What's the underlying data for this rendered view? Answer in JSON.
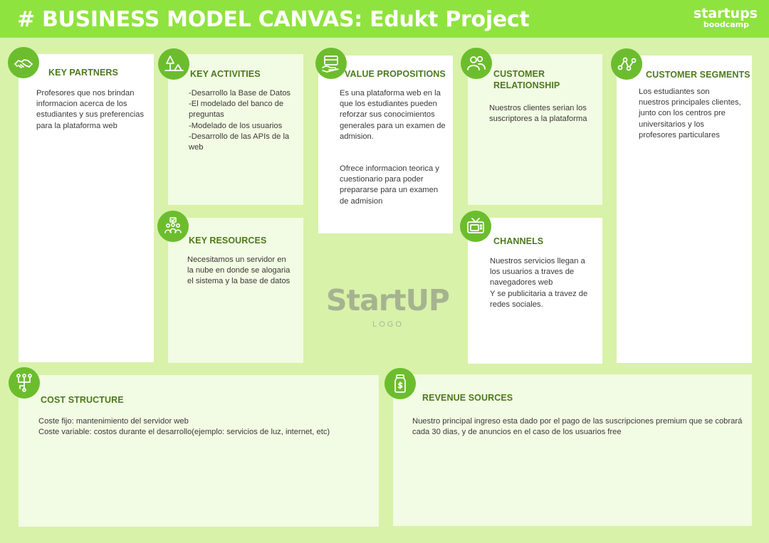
{
  "header": {
    "title": "# BUSINESS MODEL CANVAS: Edukt Project",
    "brand_main": "startups",
    "brand_sub": "boodcamp"
  },
  "blocks": {
    "key_partners": {
      "label": "KEY PARTNERS",
      "icon": "handshake-icon",
      "lines": [
        "Profesores que nos brindan informacion acerca de los estudiantes y sus preferencias para la plataforma web"
      ]
    },
    "key_activities": {
      "label": "KEY ACTIVITIES",
      "icon": "tree-tent-icon",
      "lines": [
        "-Desarrollo la Base de Datos",
        "-El modelado del banco de preguntas",
        "-Modelado de los usuarios",
        "-Desarrollo de las APIs de la web"
      ]
    },
    "key_resources": {
      "label": "KEY RESOURCES",
      "icon": "team-icon",
      "lines": [
        "Necesitamos un servidor en la nube en donde se alogaria el sistema y la base de datos"
      ]
    },
    "value_propositions": {
      "label": "VALUE PROPOSITIONS",
      "icon": "gift-box-icon",
      "lines": [
        "Es una plataforma web en la que los estudiantes pueden reforzar sus conocimientos generales para un examen de admision.",
        "Ofrece informacion teorica y cuestionario para poder prepararse para un examen de admision"
      ]
    },
    "customer_relationship": {
      "label_line1": "CUSTOMER",
      "label_line2": "RELATIONSHIP",
      "icon": "users-icon",
      "lines": [
        "Nuestros clientes serian los  suscriptores a la plataforma"
      ]
    },
    "channels": {
      "label": "CHANNELS",
      "icon": "tv-icon",
      "lines": [
        "Nuestros servicios llegan a los usuarios a traves de navegadores web",
        "Y se publicitaria a travez de redes sociales."
      ]
    },
    "customer_segments": {
      "label": "CUSTOMER SEGMENTS",
      "icon": "network-icon",
      "lines": [
        "Los estudiantes son nuestros principales clientes, junto con los centros pre universitarios y los profesores particulares"
      ]
    },
    "cost_structure": {
      "label": "COST STRUCTURE",
      "icon": "flowchart-icon",
      "lines": [
        "Coste fijo: mantenimiento del servidor web",
        "Coste variable: costos durante el desarrollo(ejemplo: servicios de luz, internet, etc)"
      ]
    },
    "revenue_sources": {
      "label": "REVENUE SOURCES",
      "icon": "money-jar-icon",
      "lines": [
        "Nuestro principal ingreso esta dado por el pago de las suscripciones premium que se cobrará cada 30 dias, y de anuncios en el caso de los usuarios free"
      ]
    }
  },
  "logo": {
    "main": "StartUP",
    "sub": "LOGO"
  },
  "colors": {
    "header_green": "#8fe33e",
    "background": "#d8f2a9",
    "icon_green": "#6cbd2e",
    "label_green": "#4c7a1d"
  }
}
